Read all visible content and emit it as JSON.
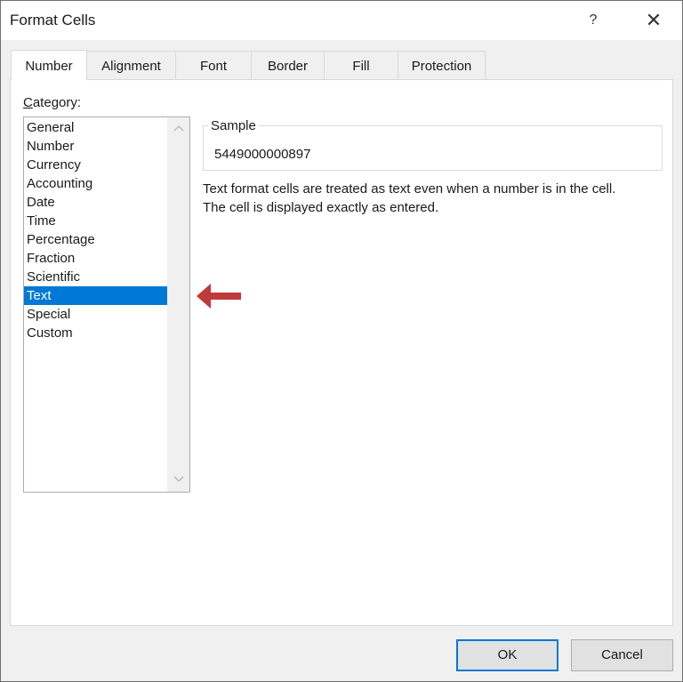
{
  "window": {
    "title": "Format Cells",
    "help_label": "?",
    "close_label": "✕"
  },
  "tabs": [
    {
      "label": "Number",
      "active": true
    },
    {
      "label": "Alignment",
      "active": false
    },
    {
      "label": "Font",
      "active": false
    },
    {
      "label": "Border",
      "active": false
    },
    {
      "label": "Fill",
      "active": false
    },
    {
      "label": "Protection",
      "active": false
    }
  ],
  "category": {
    "label_accesskey": "C",
    "label_rest": "ategory:",
    "items": [
      "General",
      "Number",
      "Currency",
      "Accounting",
      "Date",
      "Time",
      "Percentage",
      "Fraction",
      "Scientific",
      "Text",
      "Special",
      "Custom"
    ],
    "selected": "Text"
  },
  "sample": {
    "legend": "Sample",
    "value": "5449000000897"
  },
  "description": {
    "line1": "Text format cells are treated as text even when a number is in the cell.",
    "line2": "The cell is displayed exactly as entered."
  },
  "annotation": {
    "icon": "arrow-left-icon",
    "color": "#c0393b"
  },
  "buttons": {
    "ok": "OK",
    "cancel": "Cancel"
  },
  "colors": {
    "selection": "#0078d7",
    "default_button_border": "#0078d7"
  }
}
